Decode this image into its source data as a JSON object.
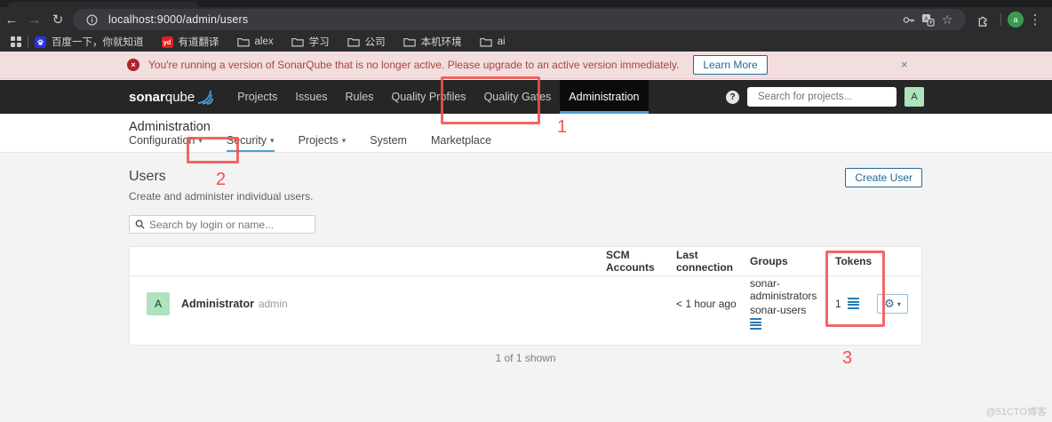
{
  "browser": {
    "url": "localhost:9000/admin/users",
    "bookmarks": [
      {
        "label": "百度一下，你就知道",
        "icon": "baidu-icon"
      },
      {
        "label": "有道翻译",
        "icon": "youdao-icon",
        "badge": "yd"
      },
      {
        "label": "alex",
        "icon": "folder-icon"
      },
      {
        "label": "学习",
        "icon": "folder-icon"
      },
      {
        "label": "公司",
        "icon": "folder-icon"
      },
      {
        "label": "本机环境",
        "icon": "folder-icon"
      },
      {
        "label": "ai",
        "icon": "folder-icon"
      }
    ],
    "profile_letter": "a"
  },
  "banner": {
    "message": "You're running a version of SonarQube that is no longer active. Please upgrade to an active version immediately.",
    "learn_more_label": "Learn More"
  },
  "navbar": {
    "logo": {
      "bold": "sonar",
      "light": "qube"
    },
    "items": [
      {
        "label": "Projects",
        "active": false
      },
      {
        "label": "Issues",
        "active": false
      },
      {
        "label": "Rules",
        "active": false
      },
      {
        "label": "Quality Profiles",
        "active": false
      },
      {
        "label": "Quality Gates",
        "active": false
      },
      {
        "label": "Administration",
        "active": true
      }
    ],
    "search_placeholder": "Search for projects...",
    "avatar_letter": "A"
  },
  "admin_header": {
    "title": "Administration",
    "tabs": [
      {
        "label": "Configuration",
        "caret": true,
        "active": false
      },
      {
        "label": "Security",
        "caret": true,
        "active": true
      },
      {
        "label": "Projects",
        "caret": true,
        "active": false
      },
      {
        "label": "System",
        "caret": false,
        "active": false
      },
      {
        "label": "Marketplace",
        "caret": false,
        "active": false
      }
    ]
  },
  "users_page": {
    "title": "Users",
    "description": "Create and administer individual users.",
    "create_button_label": "Create User",
    "search_placeholder": "Search by login or name...",
    "table": {
      "headers": [
        "SCM Accounts",
        "Last connection",
        "Groups",
        "Tokens"
      ],
      "rows": [
        {
          "avatar_letter": "A",
          "name": "Administrator",
          "login": "admin",
          "scm_accounts": "",
          "last_connection": "< 1 hour ago",
          "groups": [
            "sonar-administrators",
            "sonar-users"
          ],
          "tokens_count": "1"
        }
      ]
    },
    "footer": "1 of 1 shown"
  },
  "annotations": {
    "num1": "1",
    "num2": "2",
    "num3": "3"
  },
  "icons": {
    "close": "×",
    "caret_down": "▾",
    "gear": "⚙",
    "help": "?",
    "dots": "⋮",
    "star": "☆",
    "back": "←",
    "forward": "→",
    "reload": "↻",
    "error": "×"
  },
  "colors": {
    "accent_blue": "#236a97",
    "active_underline": "#4b9fd5",
    "banner_bg": "#f2dede",
    "banner_text": "#a94442",
    "annotation_red": "#f1504f",
    "avatar_green": "#aee3be",
    "navbar_bg": "#262626",
    "page_bg": "#f3f3f3"
  },
  "watermark": "@51CTO博客"
}
